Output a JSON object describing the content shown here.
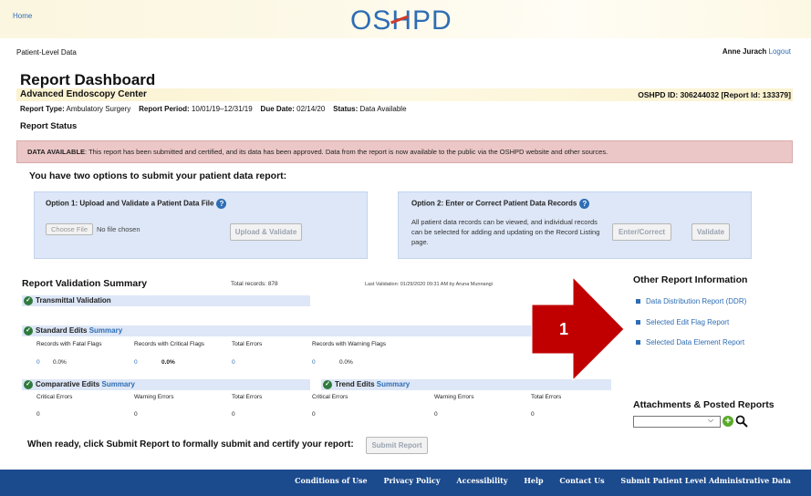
{
  "header": {
    "home_link": "Home",
    "logo_text_pre": "OS",
    "logo_text_h": "H",
    "logo_text_post": "PD"
  },
  "subheader": {
    "section": "Patient-Level Data",
    "user": "Anne Jurach",
    "logout": "Logout"
  },
  "page_title": "Report Dashboard",
  "facility": {
    "name": "Advanced Endoscopy Center",
    "oshpd_id": "OSHPD ID: 306244032 [Report Id: 133379]"
  },
  "report_meta": {
    "type_label": "Report Type:",
    "type_value": "Ambulatory Surgery",
    "period_label": "Report Period:",
    "period_value": "10/01/19–12/31/19",
    "due_label": "Due Date:",
    "due_value": "02/14/20",
    "status_label": "Status:",
    "status_value": "Data Available"
  },
  "report_status": {
    "heading": "Report Status",
    "banner_bold": "DATA AVAILABLE",
    "banner_text": ": This report has been submitted and certified, and its data has been approved. Data from the report is now available to the public via the OSHPD website and other sources."
  },
  "options": {
    "title": "You have two options to submit your patient data report:",
    "option1": {
      "title": "Option 1: Upload and Validate a Patient Data File",
      "choose_file": "Choose File",
      "no_file": "No file chosen",
      "upload_button": "Upload & Validate"
    },
    "option2": {
      "title": "Option 2: Enter or Correct Patient Data Records",
      "description": "All patient data records can be viewed, and individual records can be selected for adding and updating on the Record Listing page.",
      "enter_button": "Enter/Correct",
      "validate_button": "Validate"
    }
  },
  "validation": {
    "title": "Report Validation Summary",
    "total_records": "Total records: 878",
    "last_validation": "Last Validation: 01/29/2020 09:31 AM by Aruna Munnangi",
    "transmittal": "Transmittal Validation",
    "standard": {
      "title": "Standard Edits",
      "summary_link": "Summary",
      "headers": [
        "Records with Fatal Flags",
        "Records with Critical Flags",
        "Total Errors",
        "Records with Warning Flags"
      ],
      "values": [
        {
          "count": "0",
          "pct": "0.0%"
        },
        {
          "count": "0",
          "pct": "0.0%"
        },
        {
          "count": "0",
          "pct": ""
        },
        {
          "count": "0",
          "pct": "0.0%"
        }
      ]
    },
    "comparative": {
      "title": "Comparative Edits",
      "summary_link": "Summary",
      "headers": [
        "Critical Errors",
        "Warning Errors",
        "Total Errors"
      ],
      "values": [
        "0",
        "0",
        "0"
      ]
    },
    "trend": {
      "title": "Trend Edits",
      "summary_link": "Summary",
      "headers": [
        "Critical Errors",
        "Warning Errors",
        "Total Errors"
      ],
      "values": [
        "0",
        "0",
        "0"
      ]
    }
  },
  "other_info": {
    "title": "Other Report Information",
    "items": [
      "Data Distribution Report (DDR)",
      "Selected Edit Flag Report",
      "Selected Data Element Report"
    ]
  },
  "attachments": {
    "title": "Attachments & Posted Reports",
    "select_value": ""
  },
  "submit": {
    "prompt": "When ready, click Submit Report to formally submit and certify your report:",
    "button": "Submit Report"
  },
  "annotation": {
    "number": "1",
    "color": "#c00000"
  },
  "footer": {
    "links": [
      "Conditions of Use",
      "Privacy Policy",
      "Accessibility",
      "Help",
      "Contact Us",
      "Submit Patient Level Administrative Data"
    ]
  }
}
